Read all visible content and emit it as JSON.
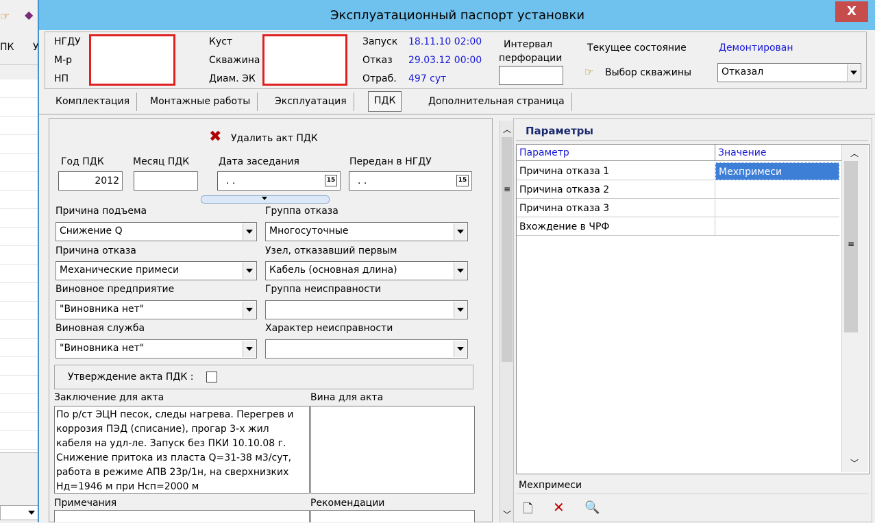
{
  "window": {
    "title": "Эксплуатационный паспорт установки",
    "close_label": "X"
  },
  "background_app": {
    "tab1": "ПК",
    "tab2": "У"
  },
  "header": {
    "ngdu_label": "НГДУ",
    "mr_label": "М-р",
    "np_label": "НП",
    "kust_label": "Куст",
    "skvazhina_label": "Скважина",
    "diam_label": "Диам. ЭК",
    "zapusk_label": "Запуск",
    "zapusk_value": "18.11.10 02:00",
    "otkaz_label": "Отказ",
    "otkaz_value": "29.03.12 00:00",
    "otrab_label": "Отраб.",
    "otrab_value": "497 сут",
    "interval_label_1": "Интервал",
    "interval_label_2": "перфорации",
    "state_label": "Текущее состояние",
    "state_value": "Демонтирован",
    "select_well_label": "Выбор скважины",
    "status_combo": "Отказал"
  },
  "tabs": [
    {
      "label": "Комплектация"
    },
    {
      "label": "Монтажные работы"
    },
    {
      "label": "Эксплуатация"
    },
    {
      "label": "ПДК"
    },
    {
      "label": "Дополнительная страница"
    }
  ],
  "pdk": {
    "delete_label": "Удалить акт ПДК",
    "year_label": "Год ПДК",
    "year_value": "2012",
    "month_label": "Месяц ПДК",
    "meeting_date_label": "Дата заседания",
    "meeting_date_value": ". .",
    "transferred_label": "Передан в НГДУ",
    "transferred_value": ". .",
    "lift_reason_label": "Причина подъема",
    "lift_reason_value": "Снижение Q",
    "failure_group_label": "Группа отказа",
    "failure_group_value": "Многосуточные",
    "failure_reason_label": "Причина отказа",
    "failure_reason_value": "Механические примеси",
    "first_node_label": "Узел, отказавший первым",
    "first_node_value": "Кабель (основная длина)",
    "guilty_company_label": "Виновное предприятие",
    "guilty_company_value": "\"Виновника нет\"",
    "fault_group_label": "Группа неисправности",
    "fault_group_value": "",
    "guilty_service_label": "Виновная служба",
    "guilty_service_value": "\"Виновника нет\"",
    "fault_character_label": "Характер неисправности",
    "fault_character_value": "",
    "approve_label": "Утверждение акта ПДК :",
    "conclusion_label": "Заключение для акта",
    "conclusion_lines": [
      "По р/ст ЭЦН песок, следы нагрева. Перегрев и",
      "коррозия ПЭД (списание), прогар 3-х жил",
      "кабеля на удл-ле. Запуск без ПКИ 10.10.08 г.",
      "Снижение притока из пласта Q=31-38 м3/сут,",
      "работа в режиме АПВ 23р/1н, на сверхнизких",
      "Нд=1946 м при Нсп=2000 м"
    ],
    "guilt_label": "Вина для акта",
    "notes_label": "Примечания",
    "recommendations_label": "Рекомендации"
  },
  "params": {
    "title": "Параметры",
    "col_param": "Параметр",
    "col_value": "Значение",
    "rows": [
      {
        "param": "Причина отказа 1",
        "value": "Мехпримеси"
      },
      {
        "param": "Причина отказа 2",
        "value": ""
      },
      {
        "param": "Причина отказа 3",
        "value": ""
      },
      {
        "param": "Вхождение в ЧРФ",
        "value": ""
      }
    ],
    "footer_text": "Мехпримеси"
  }
}
